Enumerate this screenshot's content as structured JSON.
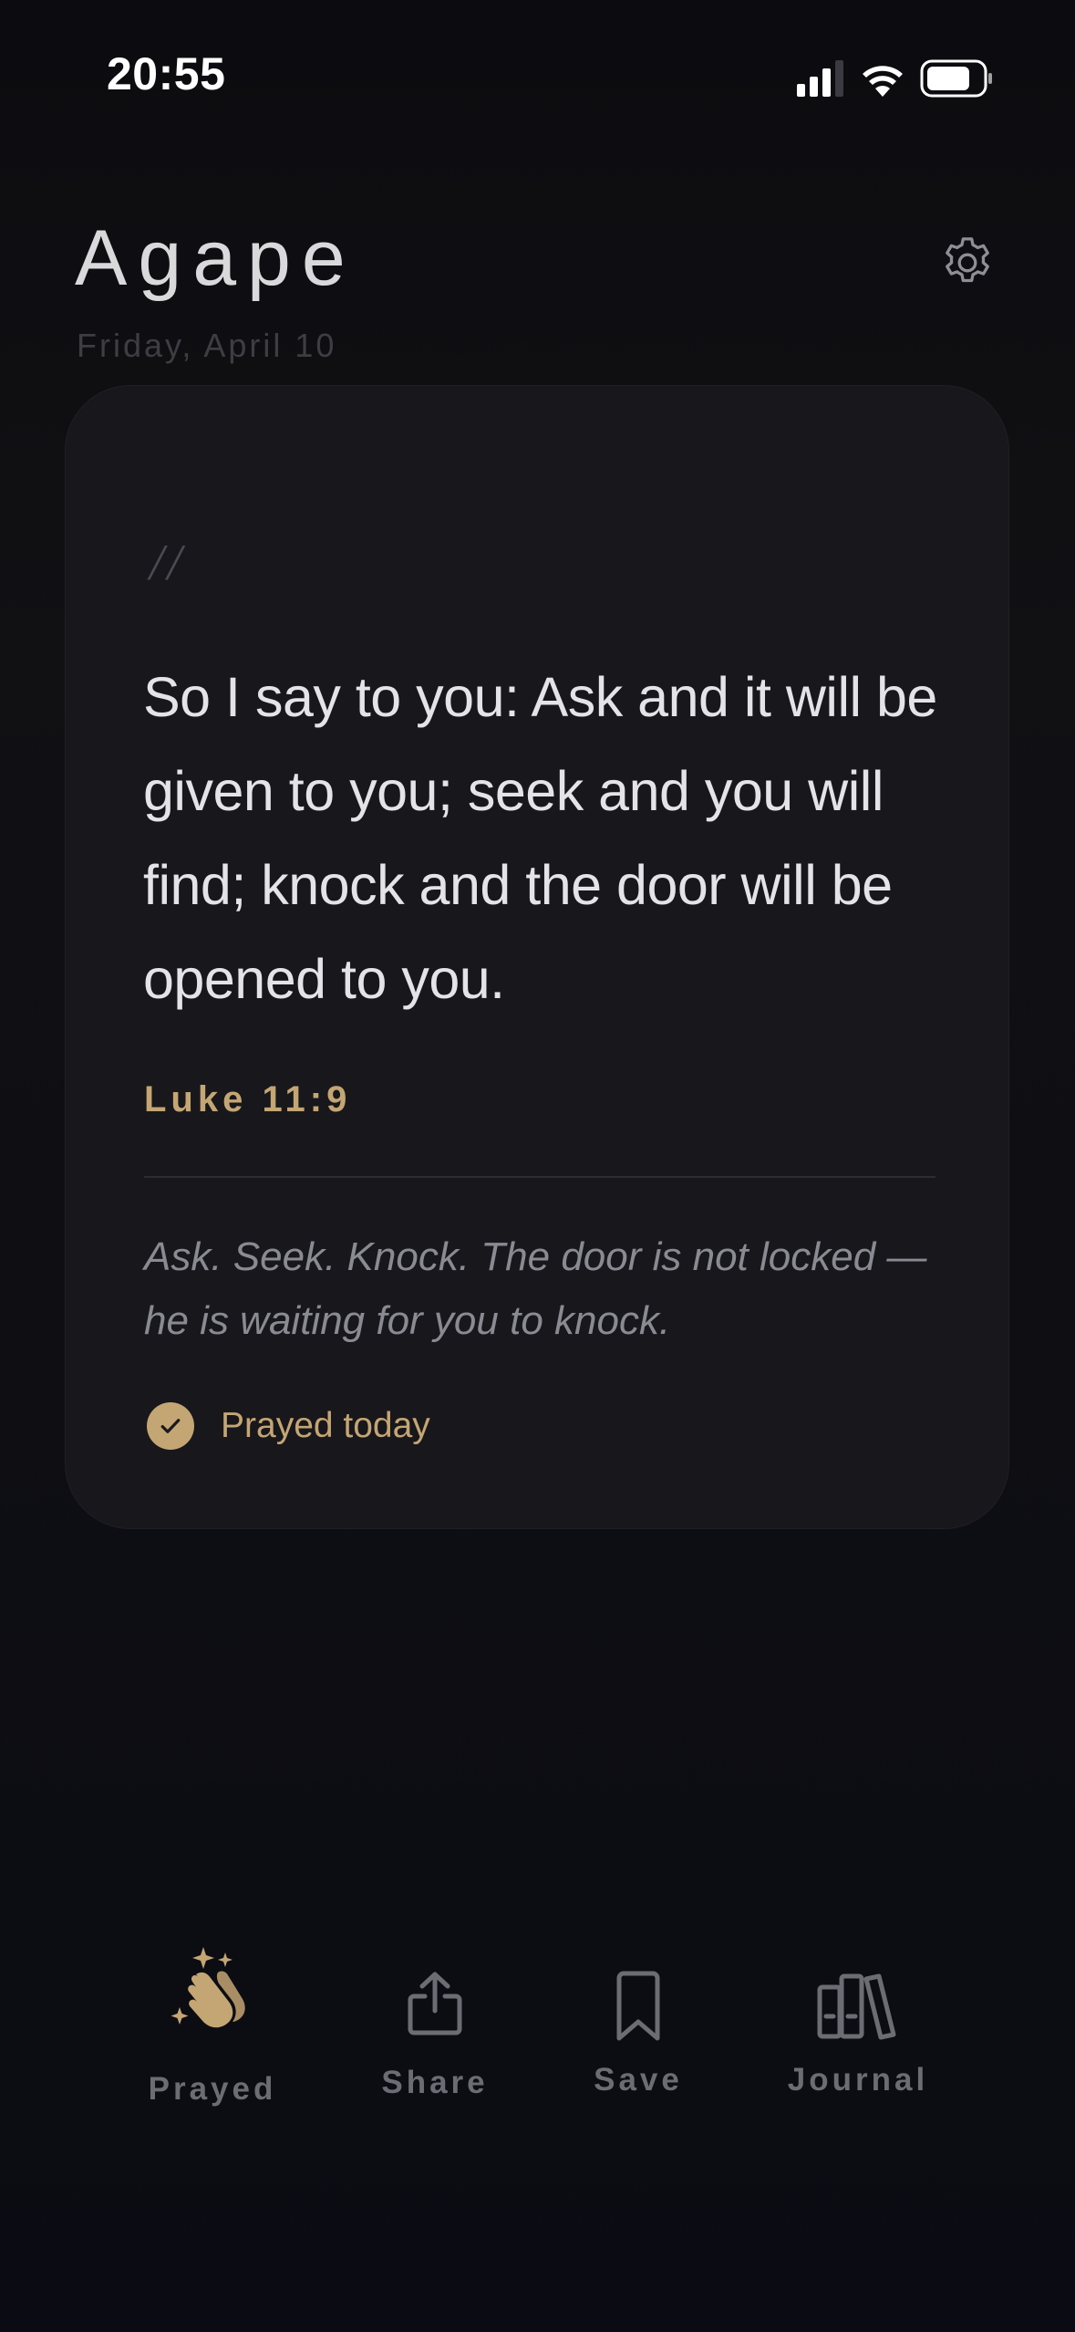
{
  "status_bar": {
    "time": "20:55"
  },
  "header": {
    "title": "Agape",
    "date": "Friday, April 10",
    "settings_icon": "gear-icon"
  },
  "card": {
    "quote_mark": "//",
    "verse": "So I say to you: Ask and it will be given to you; seek and you will find; knock and the door will be opened to you.",
    "reference": "Luke 11:9",
    "reflection": "Ask. Seek. Knock. The door is not locked — he is waiting for you to knock.",
    "prayed_status": {
      "label": "Prayed today",
      "checked": true
    }
  },
  "actions": [
    {
      "label": "Prayed",
      "icon": "praying-hands-sparkles-icon",
      "active": true
    },
    {
      "label": "Share",
      "icon": "share-icon",
      "active": false
    },
    {
      "label": "Save",
      "icon": "bookmark-icon",
      "active": false
    },
    {
      "label": "Journal",
      "icon": "books-icon",
      "active": false
    }
  ],
  "colors": {
    "background": "#0c0c10",
    "card": "#18181c",
    "accent_gold": "#c4a574",
    "text_primary": "#e4e4e8",
    "text_muted": "#8a8a92",
    "icon_inactive": "#6c6c74"
  }
}
